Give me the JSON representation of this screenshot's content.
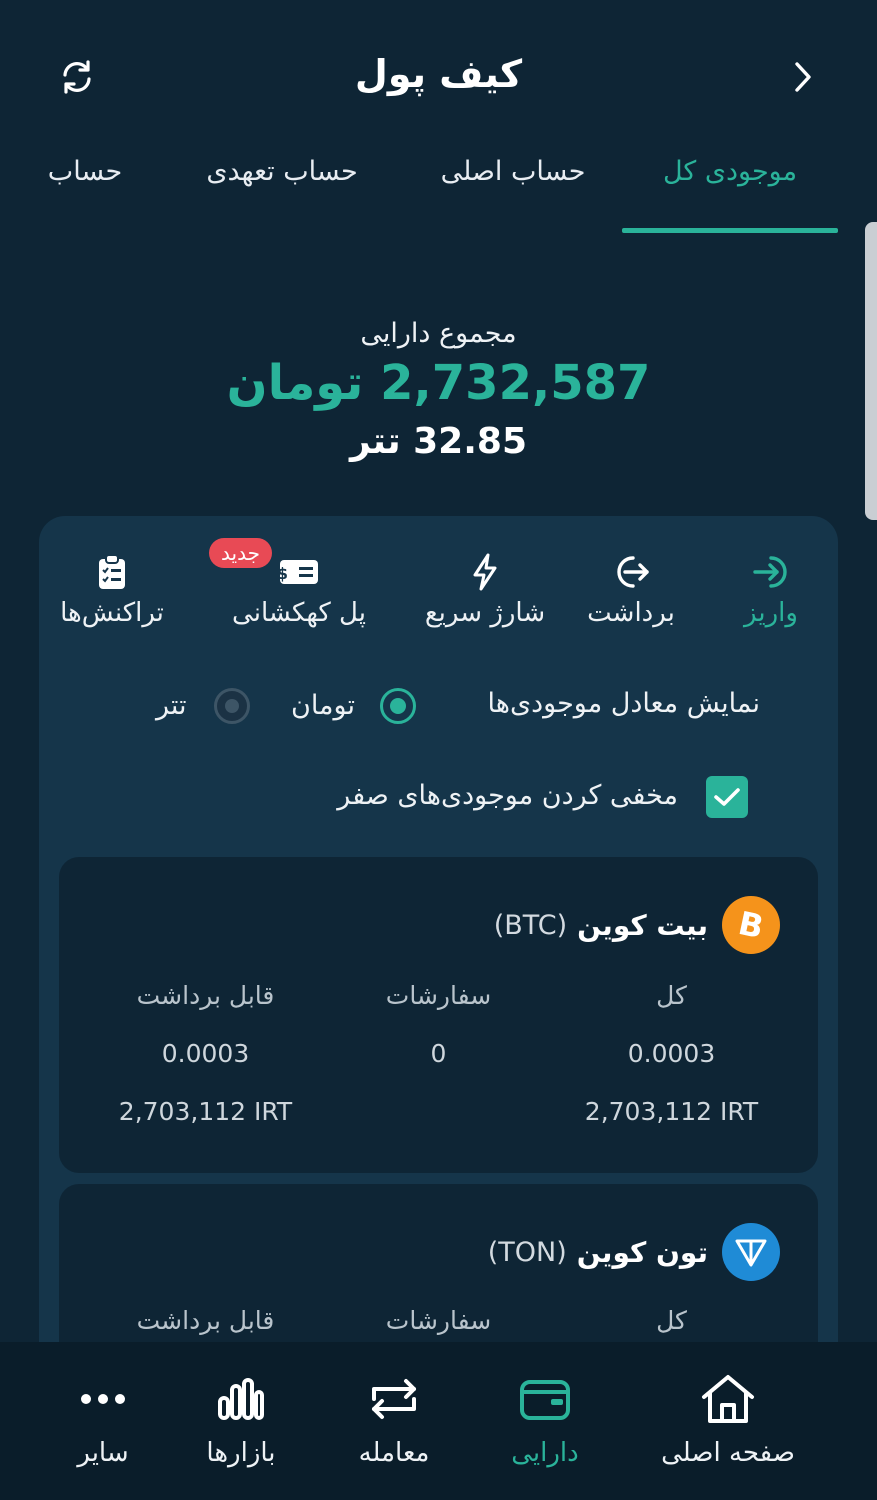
{
  "header": {
    "title": "کیف پول",
    "refresh_icon": "refresh-icon",
    "back_icon": "chevron-right-icon"
  },
  "tabs": [
    {
      "label": "موجودی کل",
      "active": true
    },
    {
      "label": "حساب اصلی",
      "active": false
    },
    {
      "label": "حساب تعهدی",
      "active": false
    },
    {
      "label": "حساب",
      "active": false
    }
  ],
  "summary": {
    "label": "مجموع دارایی",
    "toman": "2,732,587 تومان",
    "tether": "32.85 تتر"
  },
  "actions": [
    {
      "label": "واریز",
      "icon": "deposit-icon",
      "active": true
    },
    {
      "label": "برداشت",
      "icon": "withdraw-icon",
      "active": false
    },
    {
      "label": "شارژ سریع",
      "icon": "lightning-icon",
      "active": false
    },
    {
      "label": "پل کهکشانی",
      "icon": "ticket-icon",
      "active": false,
      "badge": "جدید"
    },
    {
      "label": "تراکنش‌ها",
      "icon": "clipboard-icon",
      "active": false
    }
  ],
  "equiv": {
    "label": "نمایش معادل موجودی‌ها",
    "options": [
      {
        "label": "تومان",
        "selected": true
      },
      {
        "label": "تتر",
        "selected": false
      }
    ]
  },
  "hide_zero": {
    "label": "مخفی کردن موجودی‌های صفر",
    "checked": true
  },
  "coins": [
    {
      "name": "بیت کوین",
      "symbol": "(BTC)",
      "icon": "bitcoin-icon",
      "columns": [
        {
          "header": "کل",
          "amount": "0.0003",
          "irt": "2,703,112 IRT"
        },
        {
          "header": "سفارشات",
          "amount": "0",
          "irt": ""
        },
        {
          "header": "قابل برداشت",
          "amount": "0.0003",
          "irt": "2,703,112 IRT"
        }
      ]
    },
    {
      "name": "تون کوین",
      "symbol": "(TON)",
      "icon": "toncoin-icon",
      "columns": [
        {
          "header": "کل"
        },
        {
          "header": "سفارشات"
        },
        {
          "header": "قابل برداشت"
        }
      ]
    }
  ],
  "nav": [
    {
      "label": "صفحه اصلی",
      "icon": "home-icon",
      "active": false
    },
    {
      "label": "دارایی",
      "icon": "wallet-icon",
      "active": true
    },
    {
      "label": "معامله",
      "icon": "exchange-icon",
      "active": false
    },
    {
      "label": "بازارها",
      "icon": "bar-chart-icon",
      "active": false
    },
    {
      "label": "سایر",
      "icon": "more-icon",
      "active": false
    }
  ],
  "colors": {
    "accent": "#2ab39a",
    "background": "#0e2535",
    "panel": "#15354a",
    "badge": "#e84a55",
    "bitcoin": "#f5931b",
    "toncoin": "#1f8bd6"
  }
}
